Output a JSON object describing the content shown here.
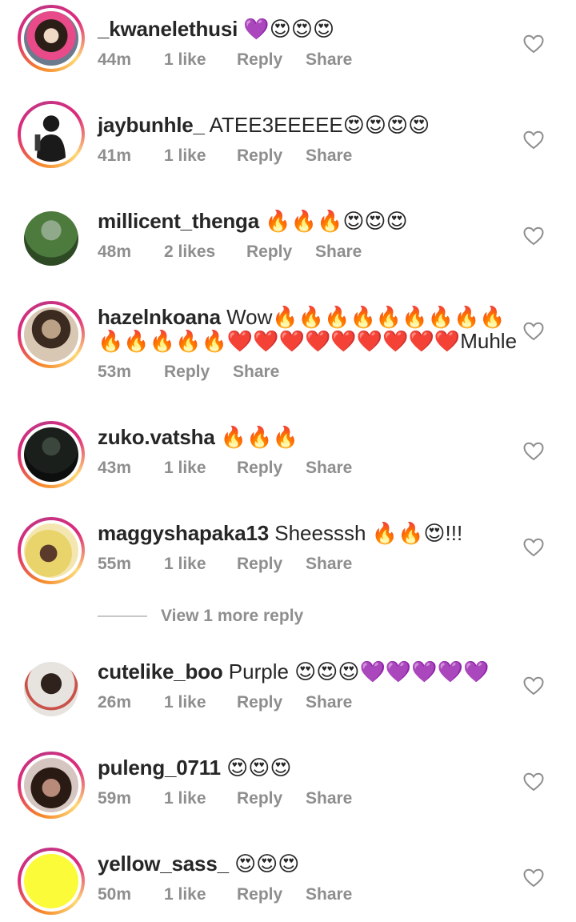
{
  "comments": [
    {
      "username": "_kwanelethusi",
      "text": "💜😍😍😍",
      "time": "44m",
      "likes": "1 like",
      "reply": "Reply",
      "share": "Share",
      "avatar_ring": true,
      "avatar_colors": [
        "#f0d9c4",
        "#2b1e17",
        "#e84a8a"
      ]
    },
    {
      "username": "jaybunhle_",
      "text": "ATEE3EEEEE😍😍😍😍",
      "time": "41m",
      "likes": "1 like",
      "reply": "Reply",
      "share": "Share",
      "avatar_ring": true,
      "avatar_colors": [
        "#ffffff",
        "#1a1a1a",
        "#3a3a3a"
      ]
    },
    {
      "username": "millicent_thenga",
      "text": "🔥🔥🔥😍😍😍",
      "time": "48m",
      "likes": "2 likes",
      "reply": "Reply",
      "share": "Share",
      "avatar_ring": false,
      "avatar_colors": [
        "#4d7a3d",
        "#2e4a24",
        "#8fa98a"
      ]
    },
    {
      "username": "hazelnkoana",
      "text": "Wow🔥🔥🔥🔥🔥🔥🔥🔥🔥",
      "text_line2": "🔥🔥🔥🔥🔥❤️❤️❤️❤️❤️❤️❤️❤️❤️Muhle",
      "time": "53m",
      "likes": "",
      "reply": "Reply",
      "share": "Share",
      "avatar_ring": true,
      "avatar_colors": [
        "#bba287",
        "#3b2a20",
        "#d8c7b3"
      ]
    },
    {
      "username": "zuko.vatsha",
      "text": "🔥🔥🔥",
      "time": "43m",
      "likes": "1 like",
      "reply": "Reply",
      "share": "Share",
      "avatar_ring": true,
      "avatar_colors": [
        "#1b1f1c",
        "#0d0f0e",
        "#3b463d"
      ]
    },
    {
      "username": "maggyshapaka13",
      "text": "Sheesssh 🔥🔥😍!!!",
      "time": "55m",
      "likes": "1 like",
      "reply": "Reply",
      "share": "Share",
      "avatar_ring": true,
      "avatar_colors": [
        "#e8d46a",
        "#5a3a2a",
        "#f4e6b0"
      ]
    },
    {
      "username": "cutelike_boo",
      "text": "Purple 😍😍😍💜💜💜💜💜",
      "time": "26m",
      "likes": "1 like",
      "reply": "Reply",
      "share": "Share",
      "avatar_ring": false,
      "avatar_colors": [
        "#e7e3df",
        "#2f221c",
        "#c9524a"
      ]
    },
    {
      "username": "puleng_0711",
      "text": "😍😍😍",
      "time": "59m",
      "likes": "1 like",
      "reply": "Reply",
      "share": "Share",
      "avatar_ring": true,
      "avatar_colors": [
        "#d6c6c2",
        "#2a1a14",
        "#b78a7a"
      ]
    },
    {
      "username": "yellow_sass_",
      "text": "😍😍😍",
      "time": "50m",
      "likes": "1 like",
      "reply": "Reply",
      "share": "Share",
      "avatar_ring": true,
      "avatar_colors": [
        "#fbfb3a",
        "#fbfb3a",
        "#fbfb3a"
      ]
    }
  ],
  "view_more_replies": "View 1 more reply",
  "colors": {
    "meta_gray": "#8e8e8e",
    "text": "#262626",
    "ring_start": "#f58529",
    "ring_mid": "#dd2a7b",
    "ring_end": "#feda77"
  }
}
